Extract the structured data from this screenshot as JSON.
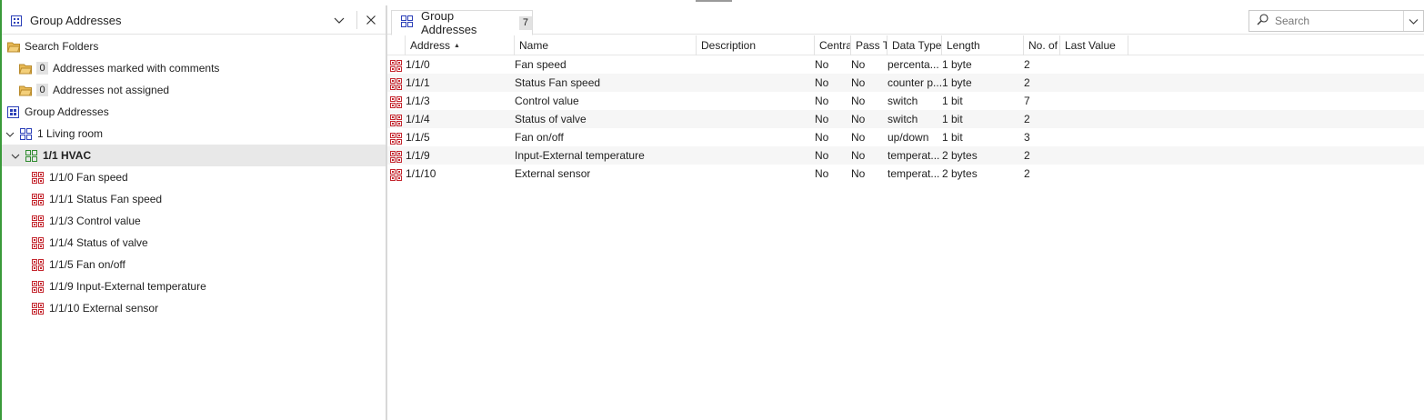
{
  "colors": {
    "group_icon": "#c4262e",
    "range_icon_blue": "#2b3fb8",
    "range_icon_green": "#2e8b2e",
    "folder": "#d9a441",
    "selection": "#e8e8e8"
  },
  "left_panel": {
    "title": "Group Addresses",
    "title_icon": "group-addresses-icon",
    "tree": {
      "search_folders_label": "Search Folders",
      "comments": {
        "count": "0",
        "label": "Addresses marked with comments"
      },
      "not_assigned": {
        "count": "0",
        "label": "Addresses not assigned"
      },
      "group_addresses_label": "Group Addresses",
      "main_group_label": "1 Living room",
      "middle_group_label": "1/1 HVAC",
      "addresses": [
        "1/1/0 Fan speed",
        "1/1/1 Status Fan speed",
        "1/1/3 Control value",
        "1/1/4 Status of valve",
        "1/1/5 Fan on/off",
        "1/1/9 Input-External temperature",
        "1/1/10 External sensor"
      ]
    }
  },
  "right_panel": {
    "tab": {
      "label": "Group Addresses",
      "count": "7"
    },
    "search": {
      "placeholder": "Search"
    },
    "columns": {
      "address": "Address",
      "name": "Name",
      "description": "Description",
      "central": "Centra",
      "pass_through": "Pass T",
      "data_type": "Data Type",
      "length": "Length",
      "no_of": "No. of",
      "last_value": "Last Value"
    },
    "rows": [
      {
        "address": "1/1/0",
        "name": "Fan speed",
        "description": "",
        "central": "No",
        "pass": "No",
        "data_type": "percenta...",
        "length": "1 byte",
        "no_of": "2",
        "last_value": ""
      },
      {
        "address": "1/1/1",
        "name": "Status Fan speed",
        "description": "",
        "central": "No",
        "pass": "No",
        "data_type": "counter p...",
        "length": "1 byte",
        "no_of": "2",
        "last_value": ""
      },
      {
        "address": "1/1/3",
        "name": "Control value",
        "description": "",
        "central": "No",
        "pass": "No",
        "data_type": "switch",
        "length": "1 bit",
        "no_of": "7",
        "last_value": ""
      },
      {
        "address": "1/1/4",
        "name": "Status of valve",
        "description": "",
        "central": "No",
        "pass": "No",
        "data_type": "switch",
        "length": "1 bit",
        "no_of": "2",
        "last_value": ""
      },
      {
        "address": "1/1/5",
        "name": "Fan on/off",
        "description": "",
        "central": "No",
        "pass": "No",
        "data_type": "up/down",
        "length": "1 bit",
        "no_of": "3",
        "last_value": ""
      },
      {
        "address": "1/1/9",
        "name": "Input-External temperature",
        "description": "",
        "central": "No",
        "pass": "No",
        "data_type": "temperat...",
        "length": "2 bytes",
        "no_of": "2",
        "last_value": ""
      },
      {
        "address": "1/1/10",
        "name": "External sensor",
        "description": "",
        "central": "No",
        "pass": "No",
        "data_type": "temperat...",
        "length": "2 bytes",
        "no_of": "2",
        "last_value": ""
      }
    ]
  }
}
